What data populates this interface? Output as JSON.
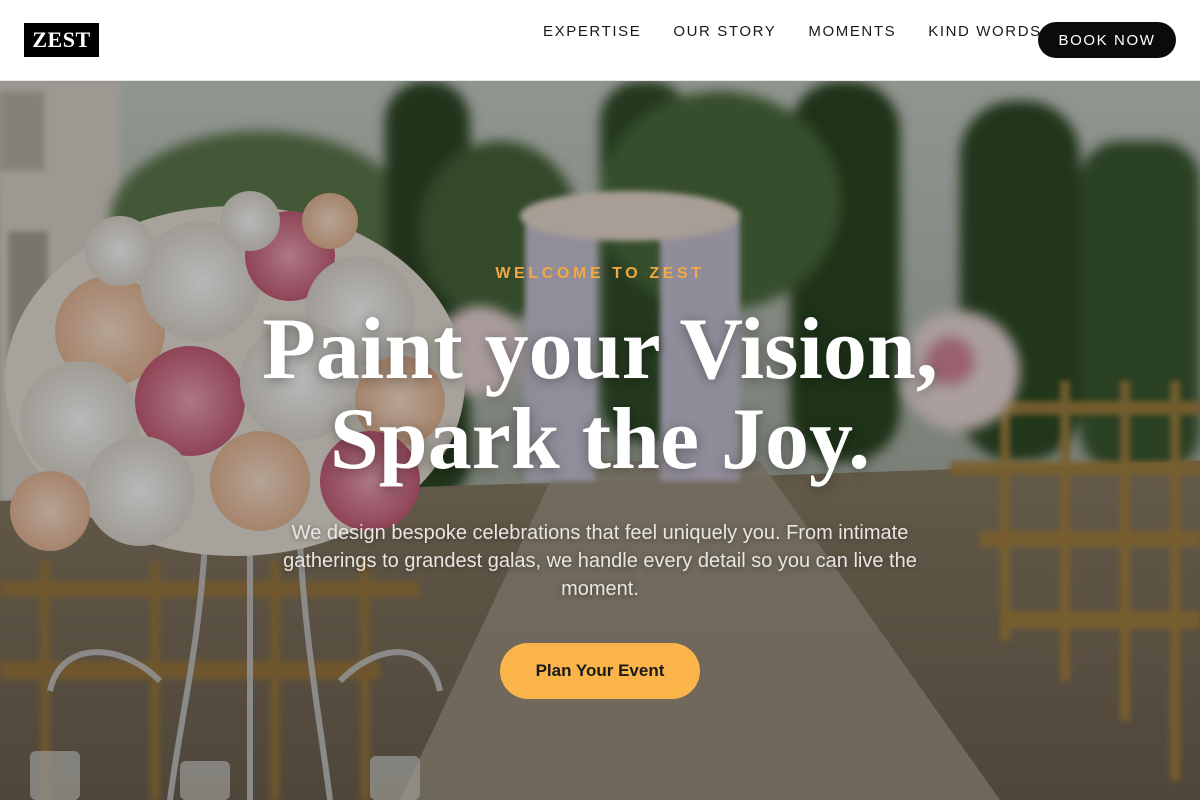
{
  "brand": {
    "logo_text": "ZEST"
  },
  "nav": {
    "items": [
      {
        "label": "EXPERTISE"
      },
      {
        "label": "OUR STORY"
      },
      {
        "label": "MOMENTS"
      },
      {
        "label": "KIND WORDS"
      }
    ],
    "cta_label": "BOOK NOW"
  },
  "hero": {
    "eyebrow": "WELCOME TO ZEST",
    "headline_line1": "Paint your Vision,",
    "headline_line2": "Spark the Joy.",
    "description": "We design bespoke celebrations that feel uniquely you. From intimate gatherings to grandest galas, we handle every detail so you can live the moment.",
    "cta_label": "Plan Your Event"
  },
  "colors": {
    "accent": "#f3a842",
    "cta_background": "#fbb44a",
    "header_background": "#ffffff",
    "book_button_background": "#0b0b0b"
  }
}
